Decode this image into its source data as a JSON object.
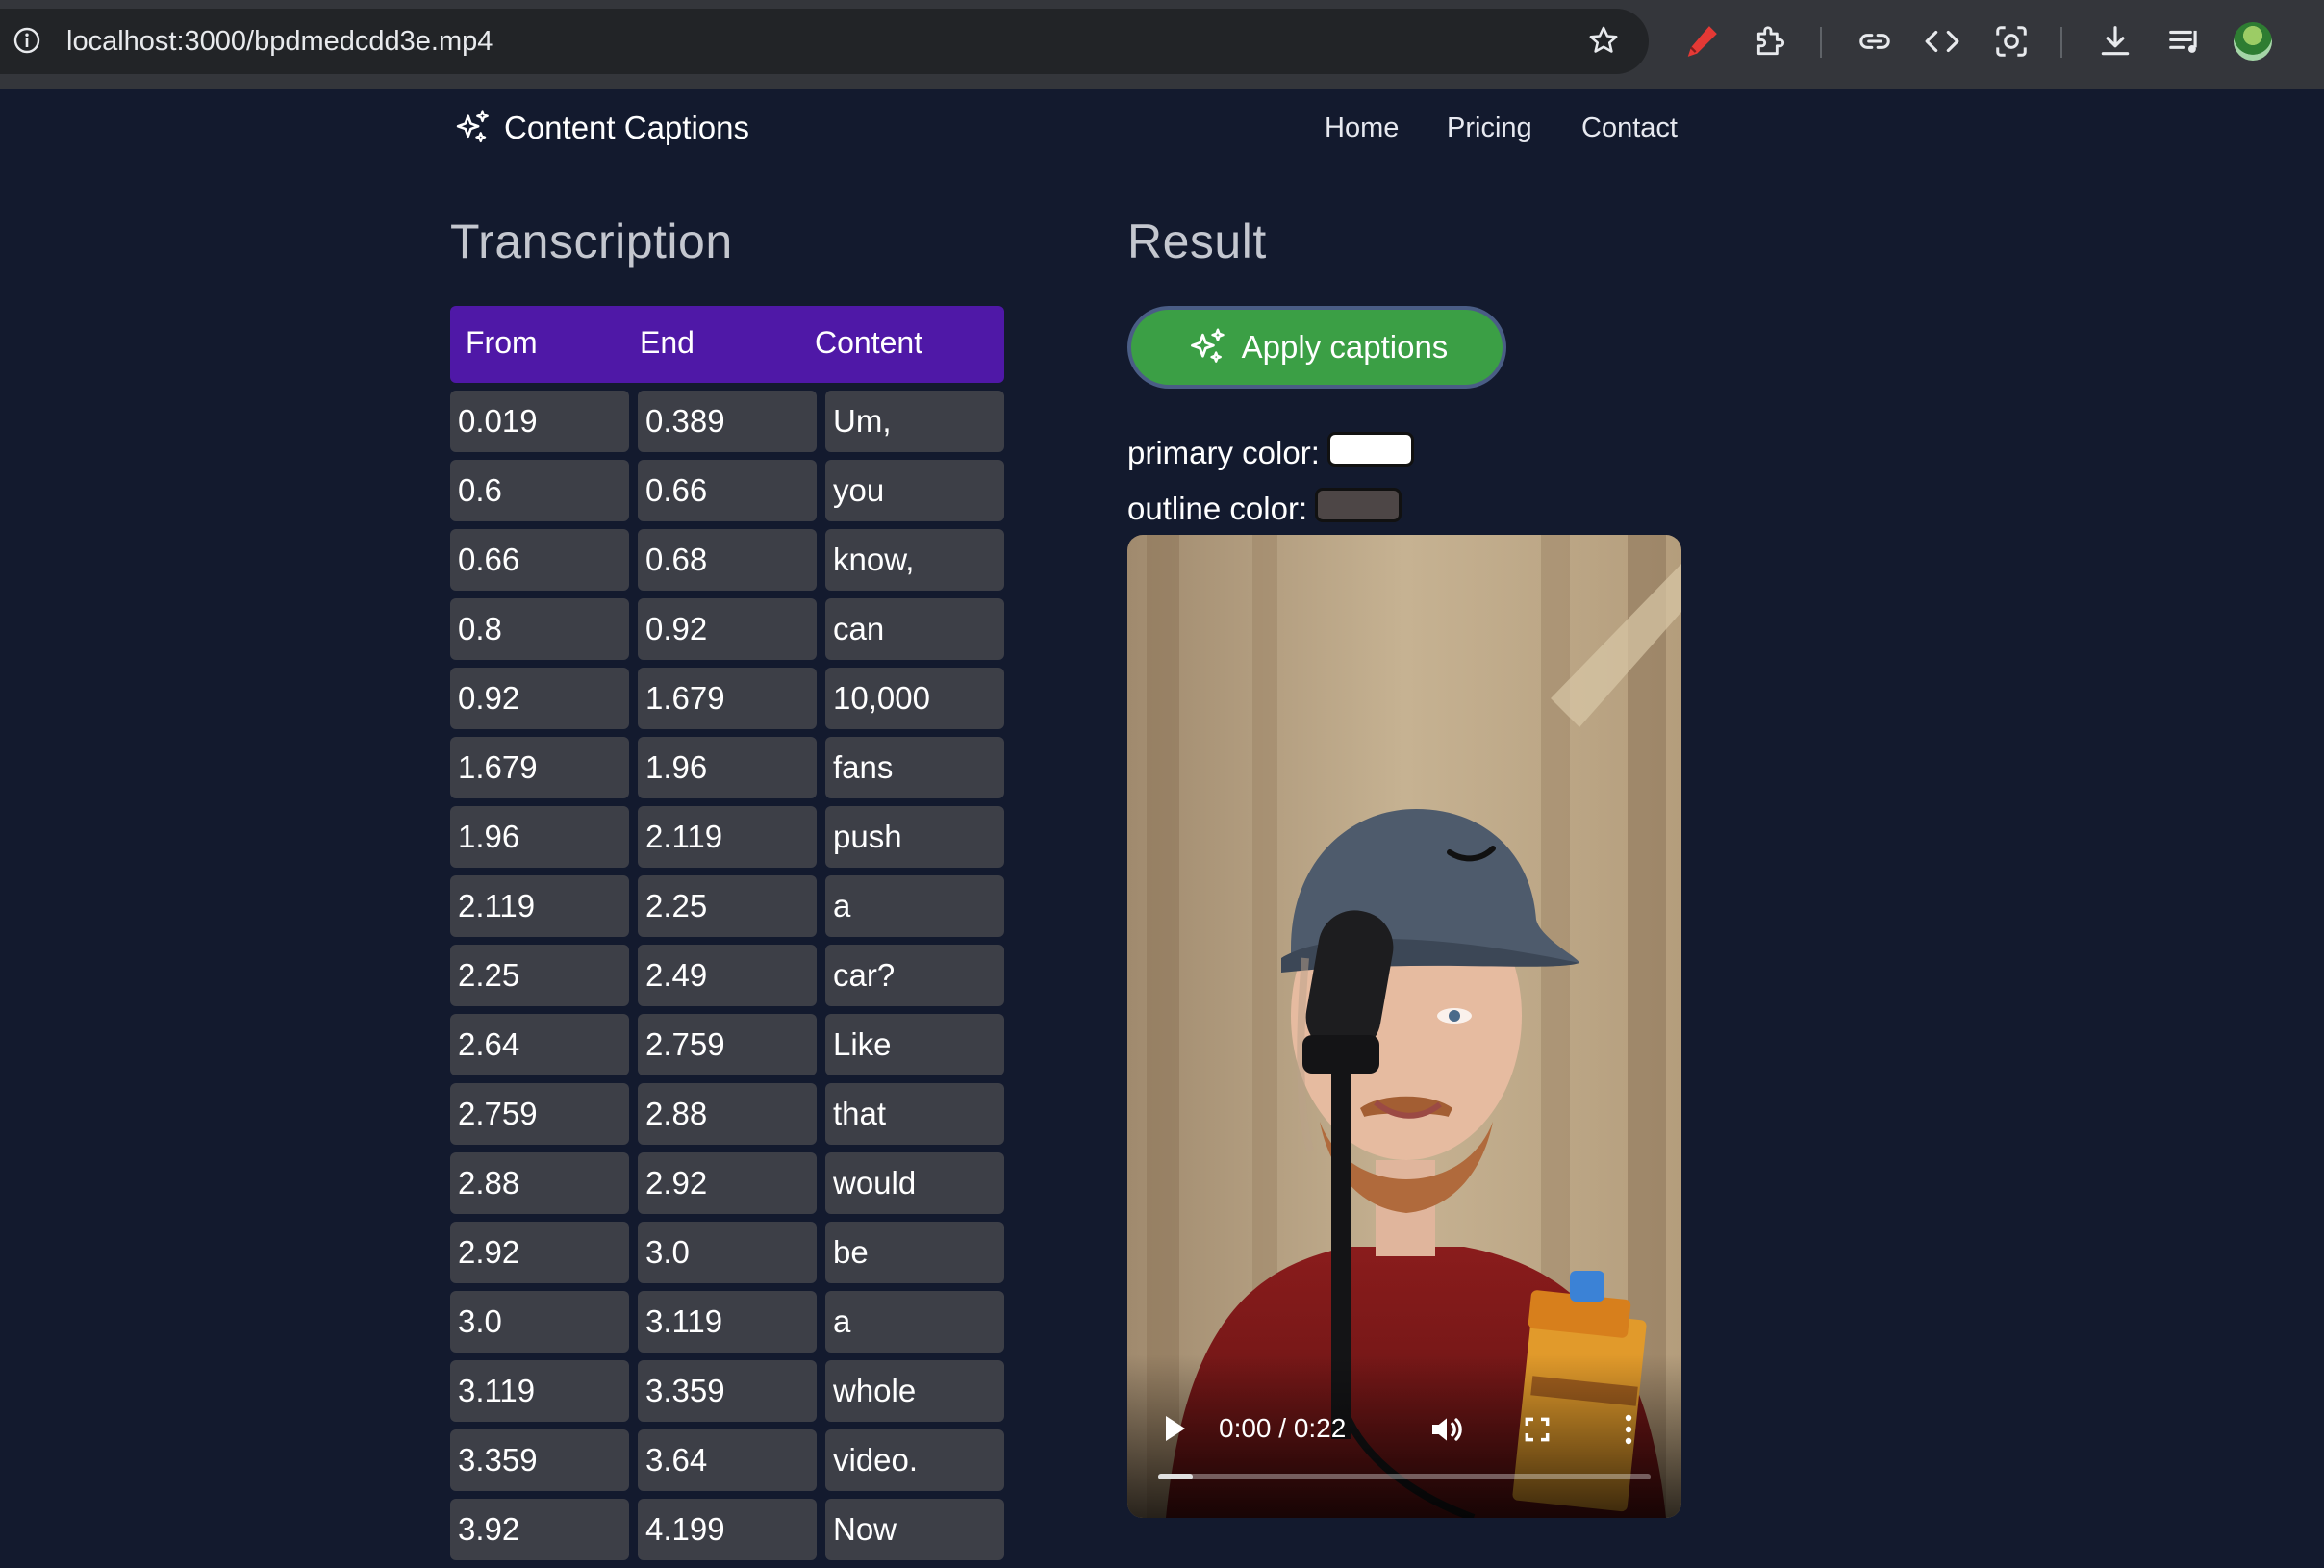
{
  "browser": {
    "url": "localhost:3000/bpdmedcdd3e.mp4",
    "icons": [
      "site-info-icon",
      "bookmark-star-icon",
      "pen-extension-icon",
      "extensions-puzzle-icon",
      "link-icon",
      "code-icon",
      "screenshot-icon",
      "download-icon",
      "media-queue-icon",
      "profile-avatar"
    ]
  },
  "header": {
    "brand": "Content Captions",
    "nav": [
      "Home",
      "Pricing",
      "Contact"
    ]
  },
  "transcription": {
    "title": "Transcription",
    "columns": [
      "From",
      "End",
      "Content"
    ],
    "rows": [
      [
        "0.019",
        "0.389",
        "Um,"
      ],
      [
        "0.6",
        "0.66",
        "you"
      ],
      [
        "0.66",
        "0.68",
        "know,"
      ],
      [
        "0.8",
        "0.92",
        "can"
      ],
      [
        "0.92",
        "1.679",
        "10,000"
      ],
      [
        "1.679",
        "1.96",
        "fans"
      ],
      [
        "1.96",
        "2.119",
        "push"
      ],
      [
        "2.119",
        "2.25",
        "a"
      ],
      [
        "2.25",
        "2.49",
        "car?"
      ],
      [
        "2.64",
        "2.759",
        "Like"
      ],
      [
        "2.759",
        "2.88",
        "that"
      ],
      [
        "2.88",
        "2.92",
        "would"
      ],
      [
        "2.92",
        "3.0",
        "be"
      ],
      [
        "3.0",
        "3.119",
        "a"
      ],
      [
        "3.119",
        "3.359",
        "whole"
      ],
      [
        "3.359",
        "3.64",
        "video."
      ],
      [
        "3.92",
        "4.199",
        "Now"
      ]
    ]
  },
  "result": {
    "title": "Result",
    "apply_label": "Apply captions",
    "primary_color_label": "primary color:",
    "primary_color": "#ffffff",
    "outline_color_label": "outline color:",
    "outline_color": "#4d4646",
    "video": {
      "time": "0:00 / 0:22",
      "progress": 0.07
    }
  },
  "colors": {
    "page_bg": "#131a2e",
    "table_header": "#4f18a7",
    "cell_bg": "#3d3f47",
    "button_green": "#3b9f45"
  }
}
